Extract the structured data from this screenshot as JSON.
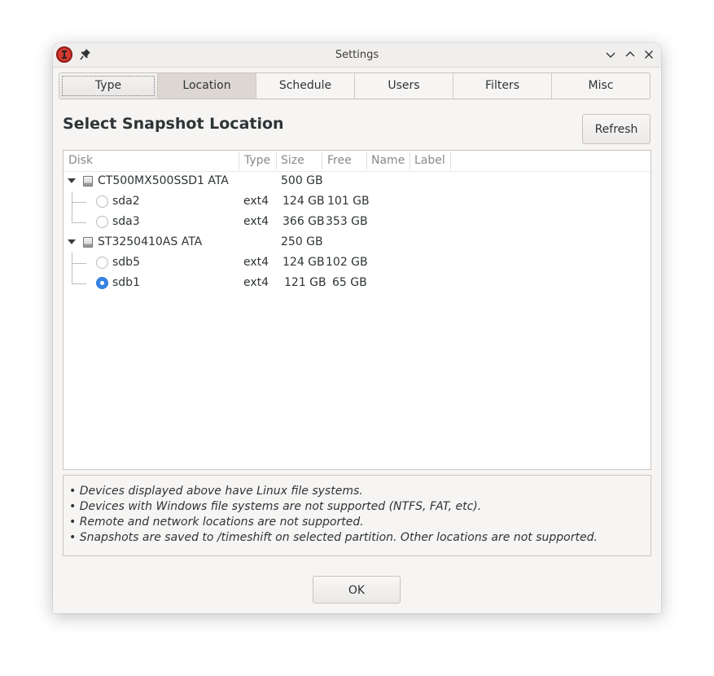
{
  "window": {
    "title": "Settings"
  },
  "tabs": [
    {
      "label": "Type"
    },
    {
      "label": "Location"
    },
    {
      "label": "Schedule"
    },
    {
      "label": "Users"
    },
    {
      "label": "Filters"
    },
    {
      "label": "Misc"
    }
  ],
  "active_tab": "Location",
  "heading": "Select Snapshot Location",
  "refresh_label": "Refresh",
  "table": {
    "columns": [
      "Disk",
      "Type",
      "Size",
      "Free",
      "Name",
      "Label"
    ],
    "disks": [
      {
        "name": "CT500MX500SSD1 ATA",
        "size": "500 GB",
        "partitions": [
          {
            "name": "sda2",
            "type": "ext4",
            "size": "124 GB",
            "free": "101 GB",
            "selected": false
          },
          {
            "name": "sda3",
            "type": "ext4",
            "size": "366 GB",
            "free": "353 GB",
            "selected": false
          }
        ]
      },
      {
        "name": "ST3250410AS ATA",
        "size": "250 GB",
        "partitions": [
          {
            "name": "sdb5",
            "type": "ext4",
            "size": "124 GB",
            "free": "102 GB",
            "selected": false
          },
          {
            "name": "sdb1",
            "type": "ext4",
            "size": "121 GB",
            "free": "65 GB",
            "selected": true
          }
        ]
      }
    ]
  },
  "info_lines": [
    "• Devices displayed above have Linux file systems.",
    "• Devices with Windows file systems are not supported (NTFS, FAT, etc).",
    "• Remote and network locations are not supported.",
    "• Snapshots are saved to /timeshift on selected partition. Other locations are not supported."
  ],
  "ok_label": "OK",
  "colors": {
    "accent": "#3584e4",
    "app_icon": "#d6392f"
  }
}
